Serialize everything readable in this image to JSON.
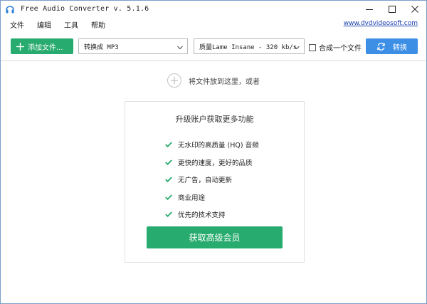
{
  "window": {
    "title": "Free Audio Converter v. 5.1.6"
  },
  "menu": {
    "items": [
      "文件",
      "编辑",
      "工具",
      "帮助"
    ],
    "link": "www.dvdvideosoft.com"
  },
  "toolbar": {
    "add_label": "添加文件...",
    "format_value": "转换成 MP3",
    "quality_value": "质量Lame Insane - 320 kb/s",
    "merge_label": "合成一个文件",
    "merge_checked": false,
    "convert_label": "转换"
  },
  "drop": {
    "hint": "将文件放到这里，或者"
  },
  "upgrade": {
    "title": "升级账户获取更多功能",
    "features": [
      "无水印的高质量 (HQ) 音频",
      "更快的速度，更好的品质",
      "无广告，自动更新",
      "商业用途",
      "优先的技术支持"
    ],
    "button_label": "获取高级会员"
  },
  "colors": {
    "green": "#27ab6e",
    "blue": "#3d8fe6",
    "link": "#1a3fb0"
  },
  "icons": {
    "app": "headphones-icon",
    "add": "plus-icon",
    "convert": "refresh-icon",
    "check": "check-icon"
  }
}
